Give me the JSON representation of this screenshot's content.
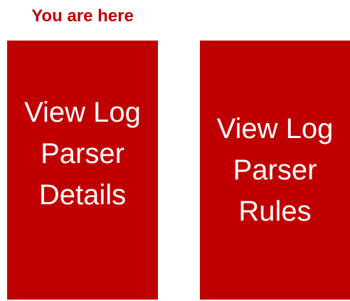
{
  "indicator": {
    "label": "You are here",
    "color": "#c00000"
  },
  "panels": [
    {
      "label": "View Log\nParser\nDetails",
      "color": "#c00000",
      "current": true
    },
    {
      "label": "View Log\nParser\nRules",
      "color": "#c00000",
      "current": false
    }
  ]
}
